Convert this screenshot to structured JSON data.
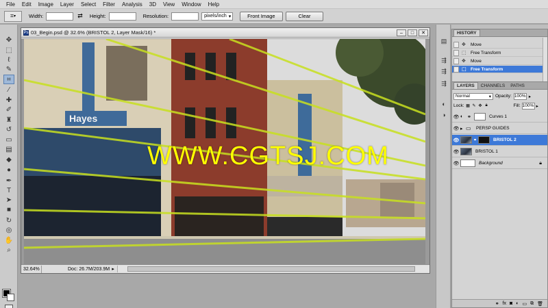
{
  "menubar": {
    "items": [
      "File",
      "Edit",
      "Image",
      "Layer",
      "Select",
      "Filter",
      "Analysis",
      "3D",
      "View",
      "Window",
      "Help"
    ]
  },
  "options": {
    "width_label": "Width:",
    "width_value": "",
    "height_label": "Height:",
    "height_value": "",
    "resolution_label": "Resolution:",
    "resolution_value": "",
    "units_value": "pixels/inch",
    "front_image_label": "Front Image",
    "clear_label": "Clear"
  },
  "document": {
    "title": "03_Begin.psd @ 32.6% (BRISTOL 2, Layer Mask/16) *",
    "zoom": "32.64%",
    "doc_size": "Doc: 26.7M/203.9M",
    "watermark": "WWW.CGTSJ.COM"
  },
  "history": {
    "tab_label": "HISTORY",
    "items": [
      {
        "label": "Move",
        "selected": false
      },
      {
        "label": "Free Transform",
        "selected": false
      },
      {
        "label": "Move",
        "selected": false
      },
      {
        "label": "Free Transform",
        "selected": true
      }
    ]
  },
  "layers": {
    "tabs": [
      "LAYERS",
      "CHANNELS",
      "PATHS"
    ],
    "blend_mode": "Normal",
    "opacity_label": "Opacity:",
    "opacity_value": "100%",
    "lock_label": "Lock:",
    "fill_label": "Fill:",
    "fill_value": "100%",
    "items": [
      {
        "name": "Curves 1",
        "type": "adjustment",
        "selected": false
      },
      {
        "name": "PERSP GUIDES",
        "type": "group",
        "selected": false
      },
      {
        "name": "BRISTOL 2",
        "type": "masked",
        "selected": true
      },
      {
        "name": "BRISTOL 1",
        "type": "photo",
        "selected": false
      },
      {
        "name": "Background",
        "type": "background",
        "selected": false
      }
    ]
  },
  "colors": {
    "guide_line": "#c8e020",
    "selection": "#3d79d8",
    "watermark": "#ffff00"
  }
}
